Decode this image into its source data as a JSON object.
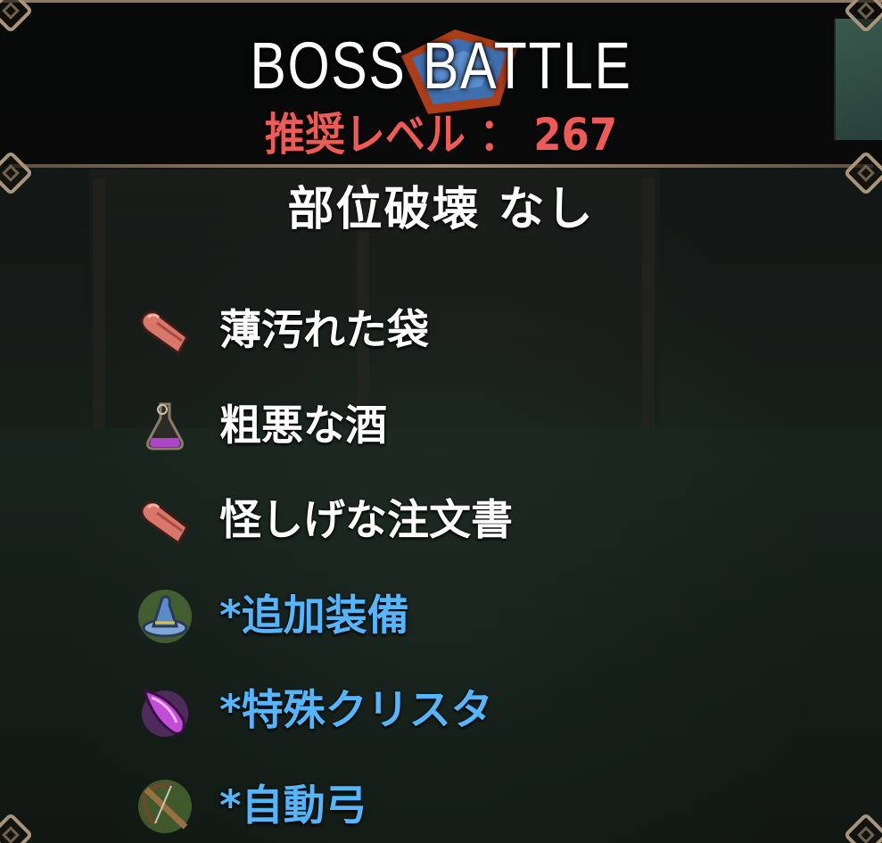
{
  "header": {
    "title": "BOSS BATTLE",
    "recommended_level": "推奨レベル ： 267"
  },
  "part_break": "部位破壊 なし",
  "rewards": [
    {
      "icon": "cloth-scroll-icon",
      "label": "薄汚れた袋",
      "extra": false
    },
    {
      "icon": "potion-flask-icon",
      "label": "粗悪な酒",
      "extra": false
    },
    {
      "icon": "cloth-scroll-icon",
      "label": "怪しげな注文書",
      "extra": false
    },
    {
      "icon": "wizard-hat-icon",
      "label": "*追加装備",
      "extra": true
    },
    {
      "icon": "crystal-icon",
      "label": "*特殊クリスタ",
      "extra": true
    },
    {
      "icon": "crossbow-icon",
      "label": "*自動弓",
      "extra": true
    }
  ],
  "colors": {
    "recommended": "#ee5a55",
    "extra_item": "#55b6ff",
    "frame": "#a8957c"
  }
}
